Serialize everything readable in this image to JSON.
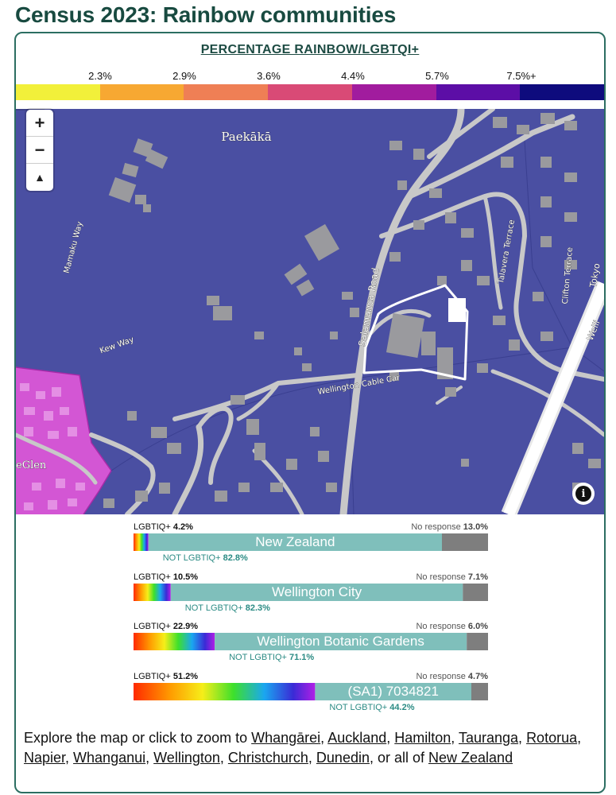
{
  "page": {
    "title": "Census 2023: Rainbow communities"
  },
  "legend": {
    "title": "PERCENTAGE RAINBOW/LGBTQI+",
    "ticks": [
      "2.3%",
      "2.9%",
      "3.6%",
      "4.4%",
      "5.7%",
      "7.5%+"
    ],
    "colors": [
      "#f2f03a",
      "#f7a832",
      "#ef7f55",
      "#d94a76",
      "#a11c9e",
      "#5c0ea6",
      "#0e0b7d"
    ]
  },
  "map": {
    "labels": {
      "suburb": "Paekākā",
      "mamaku": "Mamaku Way",
      "kew": "Kew Way",
      "salamanca": "Salamanca Road",
      "talavera": "Talavera Terrace",
      "clifton": "Clifton Terrace",
      "tokyo": "Tokyo",
      "welling": "Welli",
      "cable": "Wellington Cable Car",
      "glen": "eGlen"
    },
    "controls": {
      "zoom_in": "+",
      "zoom_out": "−",
      "compass": "▲",
      "info": "i"
    },
    "colors": {
      "base": "#4a4fa2",
      "pink_area": "#d356d4",
      "roads": "#c8c8c8",
      "buildings": "#9a9a9e",
      "highlight": "#ffffff"
    }
  },
  "comparisons": [
    {
      "lgbt_label": "LGBTIQ+",
      "lgbt_value": "4.2%",
      "lgbt": 4.2,
      "no_response_label": "No response",
      "no_response_value": "13.0%",
      "no_response": 13.0,
      "not_label": "NOT LGBTIQ+",
      "not_value": "82.8%",
      "not": 82.8,
      "name": "New Zealand"
    },
    {
      "lgbt_label": "LGBTIQ+",
      "lgbt_value": "10.5%",
      "lgbt": 10.5,
      "no_response_label": "No response",
      "no_response_value": "7.1%",
      "no_response": 7.1,
      "not_label": "NOT LGBTIQ+",
      "not_value": "82.3%",
      "not": 82.3,
      "name": "Wellington City"
    },
    {
      "lgbt_label": "LGBTIQ+",
      "lgbt_value": "22.9%",
      "lgbt": 22.9,
      "no_response_label": "No response",
      "no_response_value": "6.0%",
      "no_response": 6.0,
      "not_label": "NOT LGBTIQ+",
      "not_value": "71.1%",
      "not": 71.1,
      "name": "Wellington Botanic Gardens"
    },
    {
      "lgbt_label": "LGBTIQ+",
      "lgbt_value": "51.2%",
      "lgbt": 51.2,
      "no_response_label": "No response",
      "no_response_value": "4.7%",
      "no_response": 4.7,
      "not_label": "NOT LGBTIQ+",
      "not_value": "44.2%",
      "not": 44.2,
      "name": "(SA1) 7034821"
    }
  ],
  "explore": {
    "intro": "Explore the map or click to zoom to ",
    "links": [
      "Whangārei",
      "Auckland",
      "Hamilton",
      "Tauranga",
      "Rotorua",
      "Napier",
      "Whanganui",
      "Wellington",
      "Christchurch",
      "Dunedin"
    ],
    "outro": ", or all of ",
    "final_link": "New Zealand"
  }
}
